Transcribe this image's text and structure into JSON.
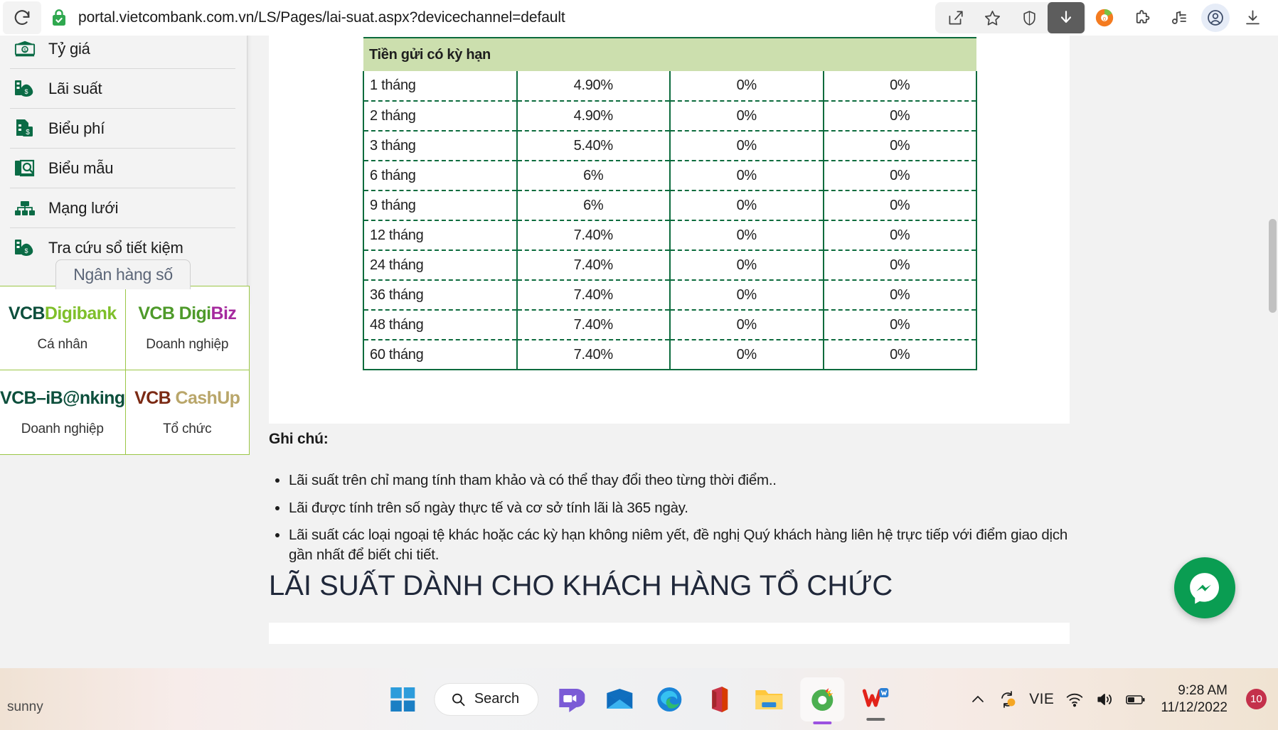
{
  "browser": {
    "url": "portal.vietcombank.com.vn/LS/Pages/lai-suat.aspx?devicechannel=default",
    "reload_label": "Reload",
    "icons": {
      "reload": "reload-icon",
      "lock": "lock-icon",
      "share": "share-icon",
      "favorite": "star-icon",
      "shield": "shield-icon",
      "download_active": "download-icon",
      "coccoc": "coccoc-icon",
      "extensions": "puzzle-icon",
      "collections": "collections-icon",
      "profile": "profile-icon",
      "downloads": "download-tray-icon"
    }
  },
  "sidebar": {
    "items": [
      {
        "label": "Tỷ giá",
        "icon": "exchange-rate-icon"
      },
      {
        "label": "Lãi suất",
        "icon": "interest-rate-icon"
      },
      {
        "label": "Biểu phí",
        "icon": "fee-schedule-icon"
      },
      {
        "label": "Biểu mẫu",
        "icon": "forms-icon"
      },
      {
        "label": "Mạng lưới",
        "icon": "network-icon"
      },
      {
        "label": "Tra cứu sổ tiết kiệm",
        "icon": "savings-book-icon"
      }
    ]
  },
  "digital_banking": {
    "tab_label": "Ngân hàng số",
    "cells": [
      {
        "logo_a": "VCB",
        "logo_b": "Digibank",
        "color_a": "#0d4f3c",
        "color_b": "#7fbf2a",
        "sub": "Cá nhân"
      },
      {
        "logo_a": "VCB Digi",
        "logo_b": "Biz",
        "color_a": "#4e9a2a",
        "color_b": "#a5299e",
        "sub": "Doanh nghiệp"
      },
      {
        "logo_a": "VCB–iB@nking",
        "logo_b": "",
        "color_a": "#0d4f3c",
        "color_b": "#0d4f3c",
        "sub": "Doanh nghiệp"
      },
      {
        "logo_a": "VCB",
        "logo_b": "CashUp",
        "color_a": "#7b2a14",
        "color_b": "#b9a66a",
        "sub": "Tổ chức"
      }
    ]
  },
  "rates_table": {
    "group_header": "Tiền gửi có kỳ hạn",
    "rows": [
      {
        "term": "1 tháng",
        "vnd": "4.90%",
        "usd": "0%",
        "eur": "0%"
      },
      {
        "term": "2 tháng",
        "vnd": "4.90%",
        "usd": "0%",
        "eur": "0%"
      },
      {
        "term": "3 tháng",
        "vnd": "5.40%",
        "usd": "0%",
        "eur": "0%"
      },
      {
        "term": "6 tháng",
        "vnd": "6%",
        "usd": "0%",
        "eur": "0%"
      },
      {
        "term": "9 tháng",
        "vnd": "6%",
        "usd": "0%",
        "eur": "0%"
      },
      {
        "term": "12 tháng",
        "vnd": "7.40%",
        "usd": "0%",
        "eur": "0%"
      },
      {
        "term": "24 tháng",
        "vnd": "7.40%",
        "usd": "0%",
        "eur": "0%"
      },
      {
        "term": "36 tháng",
        "vnd": "7.40%",
        "usd": "0%",
        "eur": "0%"
      },
      {
        "term": "48 tháng",
        "vnd": "7.40%",
        "usd": "0%",
        "eur": "0%"
      },
      {
        "term": "60 tháng",
        "vnd": "7.40%",
        "usd": "0%",
        "eur": "0%"
      }
    ]
  },
  "notes": {
    "title": "Ghi chú:",
    "items": [
      "Lãi suất trên chỉ mang tính tham khảo và có thể thay đổi theo từng thời điểm..",
      "Lãi được tính trên số ngày thực tế và cơ sở tính lãi là 365 ngày.",
      "Lãi suất các loại ngoại tệ khác hoặc các kỳ hạn không niêm yết, đề nghị Quý khách hàng liên hệ trực tiếp với điểm giao dịch gần nhất để biết chi tiết."
    ]
  },
  "section_heading": "LÃI SUẤT DÀNH CHO KHÁCH HÀNG TỔ CHỨC",
  "chat_widget": {
    "icon": "messenger-icon",
    "color": "#0a9d52"
  },
  "taskbar": {
    "start_label": "Start",
    "search_placeholder": "Search",
    "apps": [
      {
        "name": "start-button",
        "icon": "windows-logo-icon"
      },
      {
        "name": "taskbar-app-teams",
        "icon": "teams-icon"
      },
      {
        "name": "taskbar-app-mail",
        "icon": "mail-icon"
      },
      {
        "name": "taskbar-app-edge",
        "icon": "edge-icon"
      },
      {
        "name": "taskbar-app-office",
        "icon": "office-icon"
      },
      {
        "name": "taskbar-app-explorer",
        "icon": "file-explorer-icon"
      },
      {
        "name": "taskbar-app-coccoc",
        "icon": "coccoc-icon"
      },
      {
        "name": "taskbar-app-wps",
        "icon": "wps-writer-icon"
      }
    ],
    "tray": {
      "overflow": "chevron-up-icon",
      "sync": "sync-icon",
      "language": "VIE",
      "wifi": "wifi-icon",
      "volume": "volume-icon",
      "battery": "battery-icon",
      "time": "9:28 AM",
      "date": "11/12/2022",
      "notification_count": "10"
    },
    "desktop_label": "sunny"
  }
}
